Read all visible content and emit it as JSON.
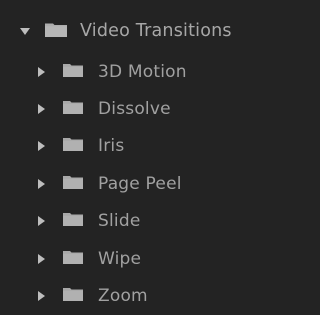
{
  "tree": {
    "root": {
      "label": "Video Transitions",
      "expanded": true,
      "icon": "folder-icon"
    },
    "children": [
      {
        "label": "3D Motion",
        "expanded": false,
        "icon": "folder-icon"
      },
      {
        "label": "Dissolve",
        "expanded": false,
        "icon": "folder-icon"
      },
      {
        "label": "Iris",
        "expanded": false,
        "icon": "folder-icon"
      },
      {
        "label": "Page Peel",
        "expanded": false,
        "icon": "folder-icon"
      },
      {
        "label": "Slide",
        "expanded": false,
        "icon": "folder-icon"
      },
      {
        "label": "Wipe",
        "expanded": false,
        "icon": "folder-icon"
      },
      {
        "label": "Zoom",
        "expanded": false,
        "icon": "folder-icon"
      }
    ]
  },
  "colors": {
    "background": "#232323",
    "text": "#a1a1a1",
    "folder": "#a9a9a9",
    "disclosure": "#bdbdbd"
  }
}
